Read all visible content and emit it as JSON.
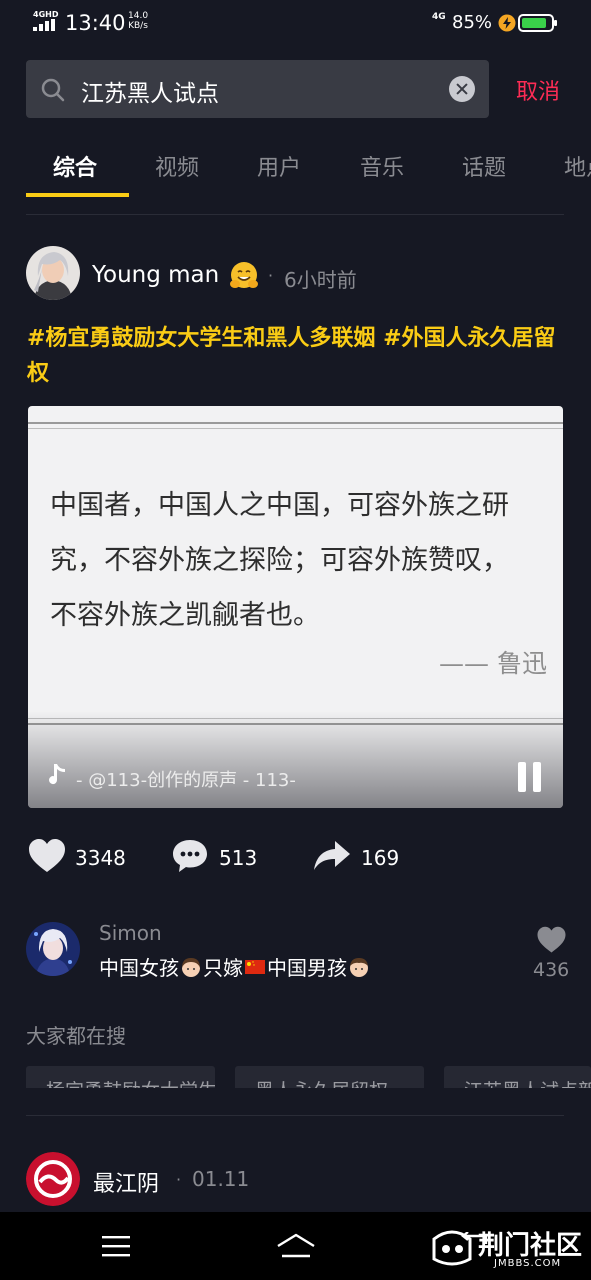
{
  "status_bar": {
    "network_label": "4GHD",
    "time": "13:40",
    "speed_value": "14.0",
    "speed_unit": "KB/s",
    "network_right": "4G",
    "battery_percent": "85%",
    "battery_level": 0.85
  },
  "search": {
    "query": "江苏黑人试点",
    "cancel_label": "取消"
  },
  "tabs": [
    {
      "label": "综合",
      "active": true
    },
    {
      "label": "视频",
      "active": false
    },
    {
      "label": "用户",
      "active": false
    },
    {
      "label": "音乐",
      "active": false
    },
    {
      "label": "话题",
      "active": false
    },
    {
      "label": "地点",
      "active": false
    }
  ],
  "post": {
    "author": "Young man",
    "separator": "·",
    "time_ago": "6小时前",
    "hashtags": "#杨宜勇鼓励女大学生和黑人多联姻 #外国人永久居留权",
    "video": {
      "quote_line1": "中国者，中国人之中国，可容外族之研",
      "quote_line2": "究，不容外族之探险；可容外族赞叹，",
      "quote_line3": "不容外族之凯觎者也。",
      "attribution": "—— 鲁迅",
      "music": "-   @113-创作的原声 - 113-"
    },
    "likes": "3348",
    "comments": "513",
    "shares": "169"
  },
  "top_comment": {
    "name": "Simon",
    "text_part1": "中国女孩",
    "text_part2": "只嫁",
    "text_part3": "中国男孩",
    "likes": "436"
  },
  "trending": {
    "title": "大家都在搜",
    "chips": [
      "杨宜勇鼓励女大学生",
      "黑人永久居留权",
      "江苏黑人试点新政"
    ]
  },
  "next_post": {
    "author": "最江阴",
    "separator": "·",
    "date": "01.11"
  },
  "watermark": {
    "main": "荆门社区",
    "sub": "JMBBS.COM"
  },
  "colors": {
    "background": "#161823",
    "accent_yellow": "#facc15",
    "accent_red": "#fe2c55",
    "muted_text": "#8a8b91"
  }
}
